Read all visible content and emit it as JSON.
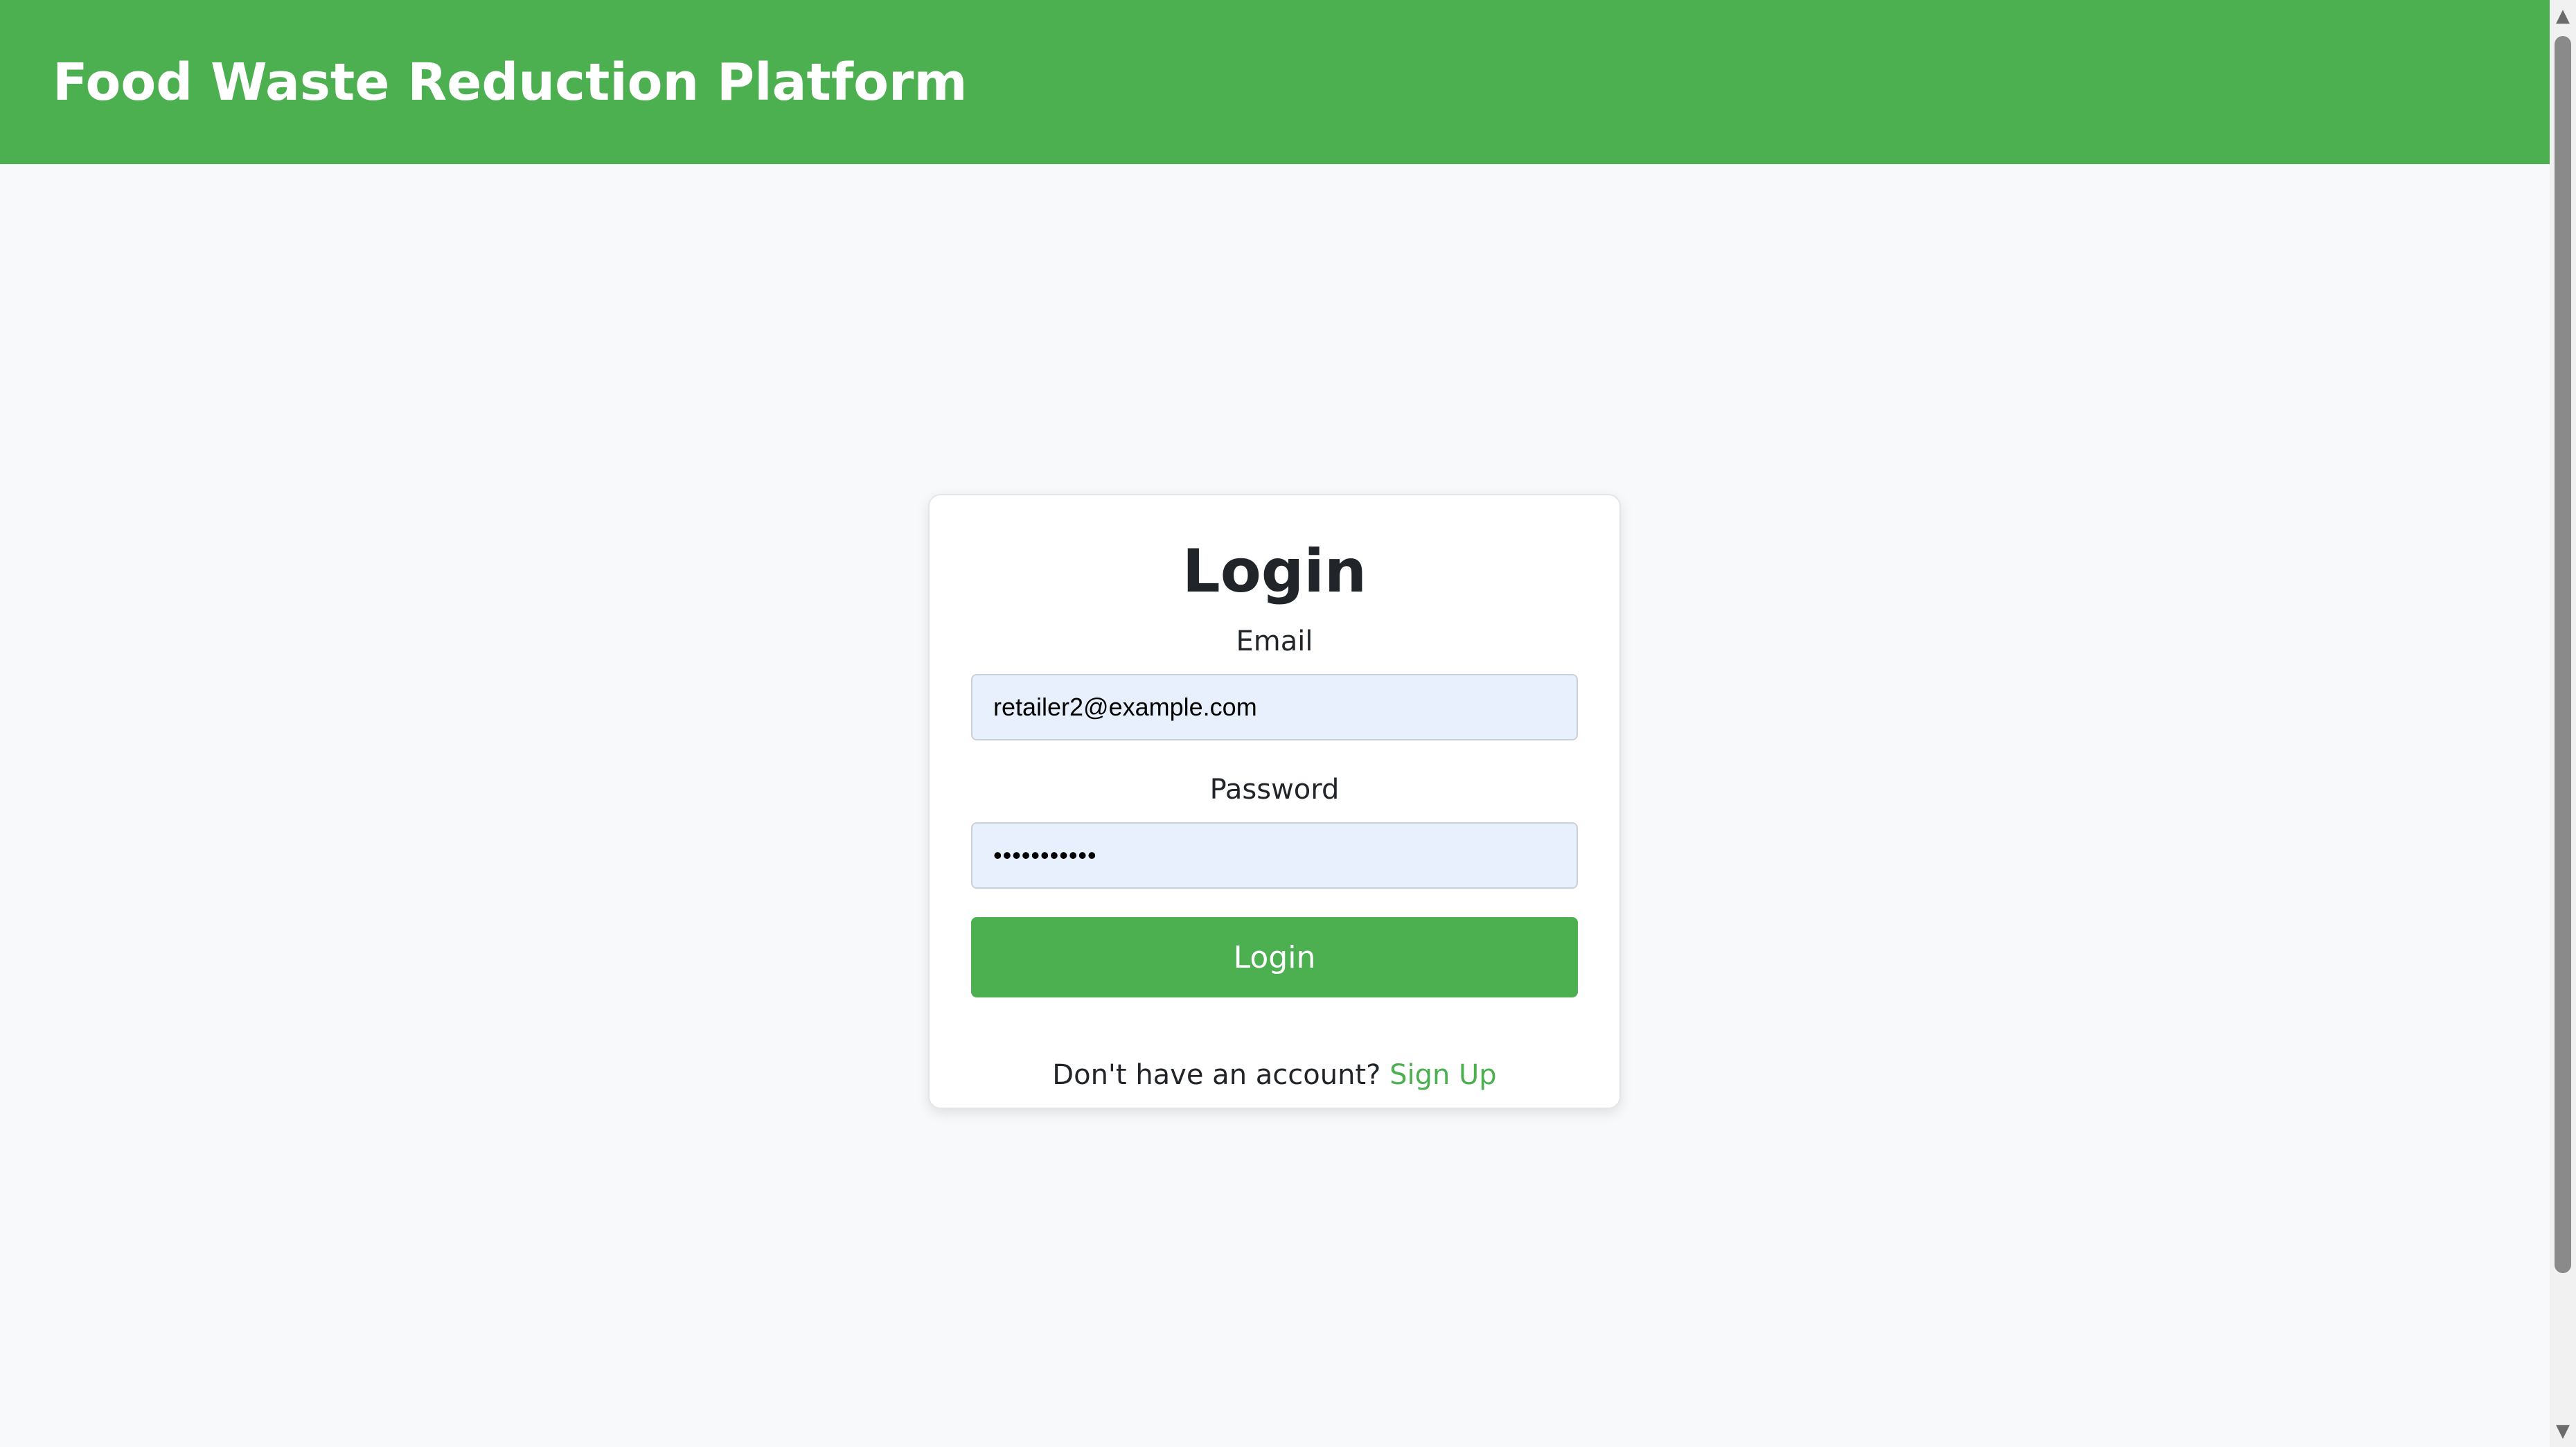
{
  "header": {
    "title": "Food Waste Reduction Platform"
  },
  "login": {
    "title": "Login",
    "email_label": "Email",
    "email_value": "retailer2@example.com",
    "password_label": "Password",
    "password_value": "•••••••••••",
    "submit_label": "Login",
    "signup_prompt": "Don't have an account?",
    "signup_link": "Sign Up"
  },
  "scrollbar": {
    "up_icon": "chevron-up-icon",
    "down_icon": "chevron-down-icon"
  },
  "colors": {
    "brand": "#4caf50",
    "background": "#f8f9fa",
    "input_fill": "#e8f0fe"
  }
}
